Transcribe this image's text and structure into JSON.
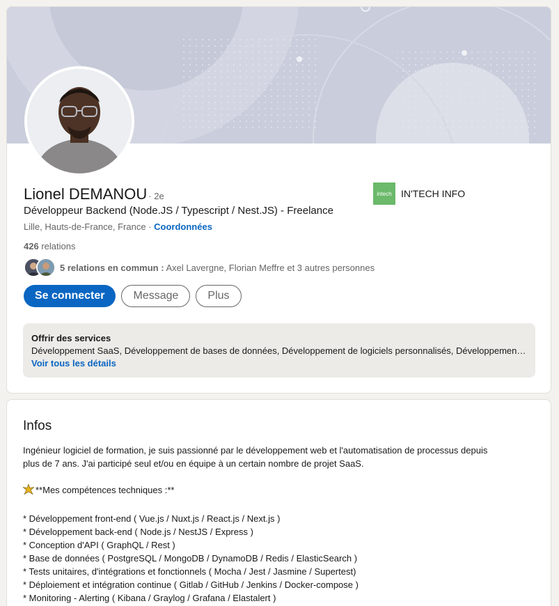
{
  "profile": {
    "name": "Lionel DEMANOU",
    "degree": "· 2e",
    "headline": "Développeur Backend (Node.JS / Typescript / Nest.JS) - Freelance",
    "location": "Lille, Hauts-de-France, France",
    "location_separator": " · ",
    "contact_link": "Coordonnées",
    "relations_count": "426",
    "relations_label": " relations",
    "mutual_bold": "5 relations en commun :",
    "mutual_rest": " Axel Lavergne, Florian Meffre et 3 autres personnes"
  },
  "company": {
    "logo_text": "intech",
    "name": "IN'TECH INFO"
  },
  "actions": {
    "connect": "Se connecter",
    "message": "Message",
    "more": "Plus"
  },
  "services": {
    "title": "Offrir des services",
    "list": "Développement SaaS, Développement de bases de données, Développement de logiciels personnalisés, Développement web, Développement d'applications",
    "link": "Voir tous les détails"
  },
  "infos": {
    "title": "Infos",
    "line1": "Ingénieur logiciel de formation, je suis passionné par le développement web et l'automatisation de processus depuis",
    "line2": "plus de 7 ans. J'ai participé seul et/ou en équipe à un certain nombre de projet SaaS.",
    "skills_heading": "**Mes compétences techniques :**",
    "skills": [
      "* Développement front-end ( Vue.js / Nuxt.js / React.js / Next.js )",
      "* Développement back-end ( Node.js / NestJS / Express )",
      "* Conception d'API ( GraphQL / Rest )",
      "* Base de données ( PostgreSQL / MongoDB / DynamoDB / Redis / ElasticSearch )",
      "* Tests unitaires, d'intégrations et fonctionnels ( Mocha / Jest / Jasmine / Supertest)",
      "* Déploiement et intégration continue ( Gitlab / GitHub / Jenkins / Docker-compose )",
      "* Monitoring - Alerting ( Kibana / Graylog / Grafana / Elastalert )"
    ]
  },
  "colors": {
    "primary": "#0a66c2",
    "company_logo": "#6bb96a",
    "banner": "#c8ccdb"
  },
  "icons": [
    "sparkle-icon"
  ]
}
